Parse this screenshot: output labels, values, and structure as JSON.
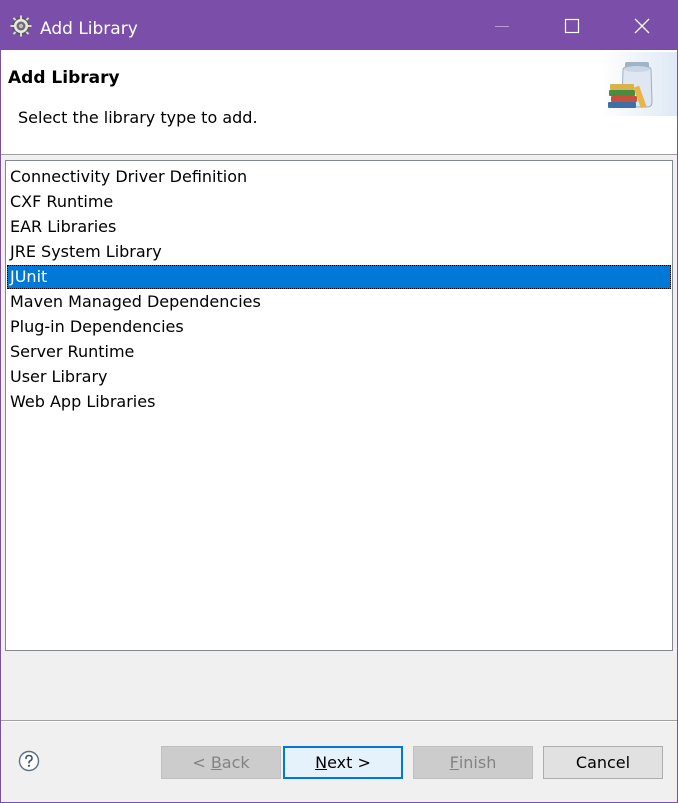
{
  "window": {
    "title": "Add Library",
    "icon": "eclipse-gear-icon",
    "controls": [
      "minimize-icon",
      "maximize-icon",
      "close-icon"
    ]
  },
  "header": {
    "title": "Add Library",
    "description": "Select the library type to add.",
    "image": "library-jar-books-icon"
  },
  "library_types": {
    "items": [
      {
        "label": "Connectivity Driver Definition",
        "selected": false
      },
      {
        "label": "CXF Runtime",
        "selected": false
      },
      {
        "label": "EAR Libraries",
        "selected": false
      },
      {
        "label": "JRE System Library",
        "selected": false
      },
      {
        "label": "JUnit",
        "selected": true
      },
      {
        "label": "Maven Managed Dependencies",
        "selected": false
      },
      {
        "label": "Plug-in Dependencies",
        "selected": false
      },
      {
        "label": "Server Runtime",
        "selected": false
      },
      {
        "label": "User Library",
        "selected": false
      },
      {
        "label": "Web App Libraries",
        "selected": false
      }
    ]
  },
  "buttons": {
    "help_icon": "help-question-icon",
    "back": {
      "prefix": "< ",
      "mnemonic": "B",
      "rest": "ack",
      "enabled": false
    },
    "next": {
      "mnemonic": "N",
      "rest": "ext >",
      "enabled": true
    },
    "finish": {
      "mnemonic": "F",
      "rest": "inish",
      "enabled": false
    },
    "cancel": {
      "label": "Cancel",
      "enabled": true
    }
  },
  "colors": {
    "titlebar": "#7b4fa9",
    "selection": "#0078d7",
    "default_button_border": "#0078d7"
  }
}
